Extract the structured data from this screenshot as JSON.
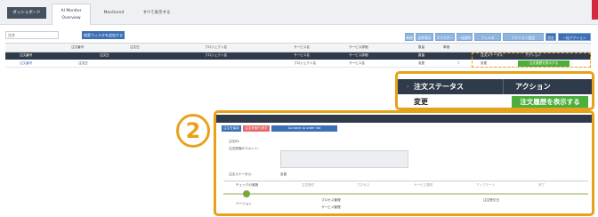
{
  "nav": {
    "tabs": [
      {
        "label": "ダッシュボード"
      },
      {
        "label": "AI Monitor",
        "sub": "Overview"
      },
      {
        "label": "Monitored"
      },
      {
        "label": "すべて表示する"
      }
    ]
  },
  "filter": {
    "search_value": "注文",
    "add_button": "検索フィルタを追加する",
    "toolbar_buttons": [
      "新規",
      "全件表示",
      "エクスポート",
      "一括操作",
      "フィルタ",
      "アクション設定",
      "設定",
      "一括アクション"
    ]
  },
  "table": {
    "columns": [
      "注文番号",
      "注文日",
      "プロジェクト名",
      "サービス名",
      "サービス詳細",
      "数量",
      "単価",
      "注文ステータス",
      "アクション"
    ],
    "row": [
      "注文番号",
      "注文日",
      "プロジェクト名",
      "サービス名",
      "サービス詳細",
      "変更",
      "7",
      "変更",
      "注文履歴を表示する"
    ]
  },
  "zoom": {
    "status_header": "注文ステータス",
    "action_header": "アクション",
    "status_value": "変更",
    "action_button": "注文履歴を表示する"
  },
  "step": {
    "number": "2"
  },
  "panel": {
    "buttons": [
      "注文を保存",
      "注文を取り消す",
      "Go back to order list"
    ],
    "fields": {
      "order_no": "注文ID:",
      "order_detail": "注文詳細のコメント:",
      "order_status": "注文ステータス:",
      "order_status_value": "変更"
    },
    "timeline": [
      "チェックの実施",
      "注文受付",
      "プロセス",
      "サービス提供",
      "アップデート",
      "完了"
    ],
    "bottom": [
      "バージョン",
      "プロセス管理",
      "サービス管理",
      "注文受付日"
    ]
  },
  "colors": {
    "accent": "#e7a21a",
    "header": "#2f3b4a",
    "action_green": "#4cae3c",
    "primary_blue": "#3b6fb6"
  }
}
